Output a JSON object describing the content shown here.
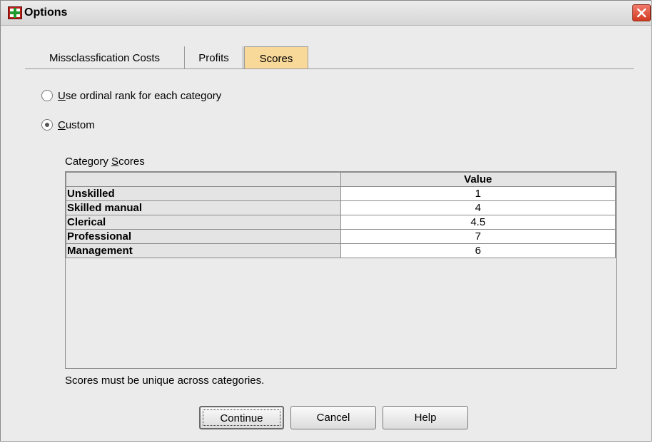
{
  "window": {
    "title": "Options",
    "app_icon": "spss-options-icon",
    "close_icon": "close-x-icon"
  },
  "tabs": [
    {
      "label": "Missclassfication Costs",
      "active": false
    },
    {
      "label": "Profits",
      "active": false
    },
    {
      "label": "Scores",
      "active": true
    }
  ],
  "options": {
    "ordinal": {
      "mnemonic": "U",
      "rest": "se ordinal rank for each category",
      "selected": false
    },
    "custom": {
      "mnemonic": "C",
      "rest": "ustom",
      "selected": true
    }
  },
  "category_scores": {
    "label_prefix": "Category ",
    "label_mnemonic": "S",
    "label_rest": "cores",
    "column_header": "Value",
    "rows": [
      {
        "category": "Unskilled",
        "value": "1"
      },
      {
        "category": "Skilled manual",
        "value": "4"
      },
      {
        "category": "Clerical",
        "value": "4.5"
      },
      {
        "category": "Professional",
        "value": "7"
      },
      {
        "category": "Management",
        "value": "6"
      }
    ]
  },
  "note": "Scores must be unique across categories.",
  "buttons": {
    "continue": "Continue",
    "cancel": "Cancel",
    "help": "Help"
  },
  "colors": {
    "active_tab": "#f9d99a",
    "dialog_bg": "#ebebeb",
    "close_button": "#d23b22"
  }
}
